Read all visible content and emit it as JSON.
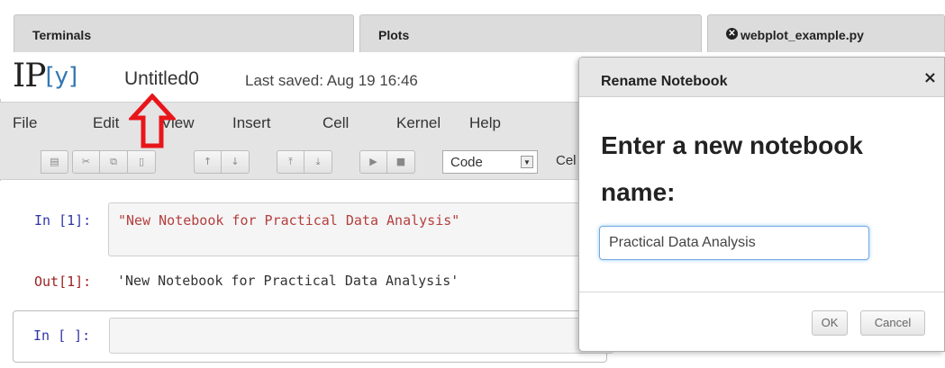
{
  "tabs": [
    {
      "label": "Terminals"
    },
    {
      "label": "Plots"
    },
    {
      "label": "webplot_example.py",
      "icon": "close-circle-icon"
    }
  ],
  "header": {
    "logo_ip": "IP",
    "logo_y": "[y]",
    "notebook_name": "Untitled0",
    "last_saved": "Last saved: Aug 19 16:46"
  },
  "menu": [
    "File",
    "Edit",
    "View",
    "Insert",
    "Cell",
    "Kernel",
    "Help"
  ],
  "toolbar": {
    "icons": [
      "save-icon",
      "cut-icon",
      "copy-icon",
      "paste-icon",
      "move-up-icon",
      "move-down-icon",
      "insert-above-icon",
      "insert-below-icon",
      "run-icon",
      "stop-icon"
    ],
    "cell_type": "Code",
    "cell_label_truncated": "Cel"
  },
  "cells": {
    "in1_prompt": "In [1]:",
    "in1_source": "\"New Notebook for Practical Data Analysis\"",
    "out1_prompt": "Out[1]:",
    "out1_text": "'New Notebook for Practical Data Analysis'",
    "in2_prompt": "In [ ]:"
  },
  "dialog": {
    "title": "Rename Notebook",
    "close": "×",
    "heading": "Enter a new notebook name:",
    "input_value": "Practical Data Analysis",
    "ok_label": "OK",
    "cancel_label": "Cancel"
  },
  "colors": {
    "annotation_arrow": "#e8151b",
    "logo_accent": "#3477b2"
  }
}
